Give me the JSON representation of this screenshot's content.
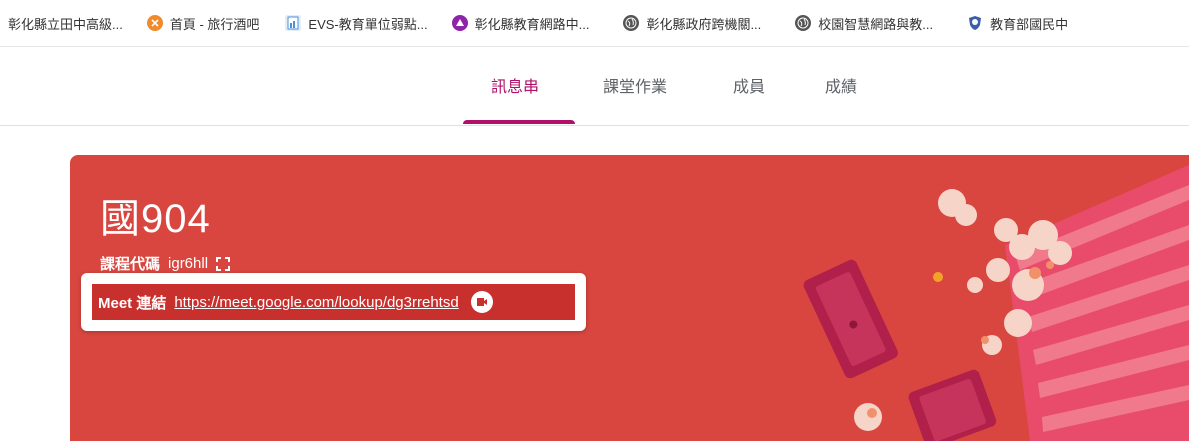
{
  "bookmarks": [
    {
      "label": "彰化縣立田中高級...",
      "icon": "none"
    },
    {
      "label": "首頁 - 旅行酒吧",
      "icon": "travel-bar-icon",
      "color": "#f08a2c"
    },
    {
      "label": "EVS-教育單位弱點...",
      "icon": "document-icon",
      "color": "#4a8fd8"
    },
    {
      "label": "彰化縣教育網路中...",
      "icon": "purple-logo-icon",
      "color": "#8e24aa"
    },
    {
      "label": "彰化縣政府跨機關...",
      "icon": "globe-icon",
      "color": "#555555"
    },
    {
      "label": "校園智慧網路與教...",
      "icon": "globe-icon",
      "color": "#555555"
    },
    {
      "label": "教育部國民中",
      "icon": "shield-icon",
      "color": "#3b5ea8"
    }
  ],
  "tabs": [
    {
      "label": "訊息串",
      "active": true
    },
    {
      "label": "課堂作業",
      "active": false
    },
    {
      "label": "成員",
      "active": false
    },
    {
      "label": "成績",
      "active": false
    }
  ],
  "course": {
    "title": "國904",
    "code_label": "課程代碼",
    "code_value": "igr6hll",
    "meet_label": "Meet 連結",
    "meet_link": "https://meet.google.com/lookup/dg3rrehtsd"
  },
  "colors": {
    "accent": "#b0106a",
    "banner": "#d9463f",
    "meet_bg": "#c8302e"
  }
}
